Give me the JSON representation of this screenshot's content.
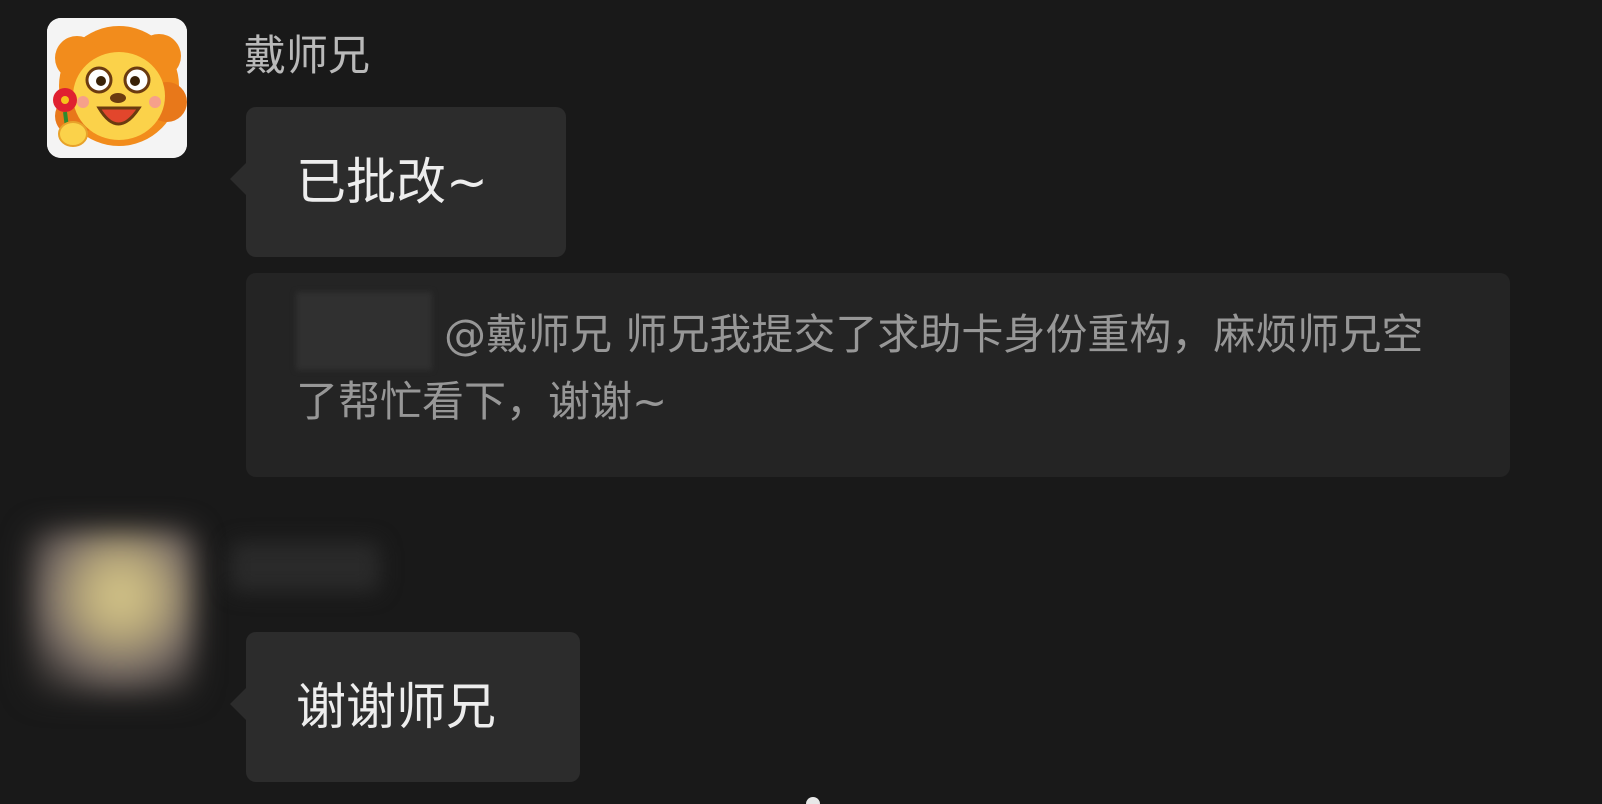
{
  "messages": [
    {
      "sender": "戴师兄",
      "text": "已批改~",
      "quote": {
        "text": "@戴师兄  师兄我提交了求助卡身份重构，麻烦师兄空了帮忙看下，谢谢~"
      }
    },
    {
      "sender": "",
      "text": "谢谢师兄"
    }
  ],
  "icons": {
    "avatar_1": "lion-avatar-icon",
    "avatar_2": "blurred-avatar"
  },
  "colors": {
    "background": "#191919",
    "bubble": "#2c2c2c",
    "quote_background": "#242424",
    "sender_name": "#b9b9b9",
    "message_text": "#ededed",
    "quote_text": "#979797"
  }
}
